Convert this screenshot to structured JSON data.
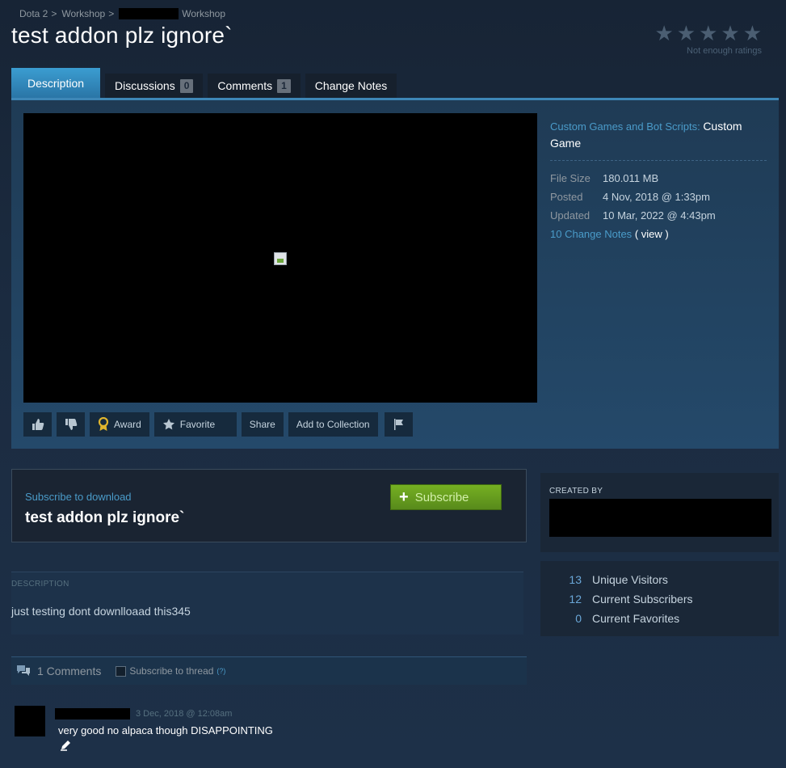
{
  "breadcrumb": {
    "items": [
      "Dota 2",
      "Workshop",
      "Workshop"
    ],
    "separator": ">"
  },
  "title": "test addon plz ignore`",
  "rating": {
    "stars": [
      "★",
      "★",
      "★",
      "★",
      "★"
    ],
    "text": "Not enough ratings"
  },
  "tabs": [
    {
      "label": "Description"
    },
    {
      "label": "Discussions",
      "badge": "0"
    },
    {
      "label": "Comments",
      "badge": "1"
    },
    {
      "label": "Change Notes"
    }
  ],
  "actions": {
    "award": "Award",
    "favorite": "Favorite",
    "share": "Share",
    "add_to_collection": "Add to Collection"
  },
  "meta": {
    "category_label": "Custom Games and Bot Scripts:",
    "category_value": "Custom Game",
    "file_size_label": "File Size",
    "file_size": "180.011 MB",
    "posted_label": "Posted",
    "posted": "4 Nov, 2018 @ 1:33pm",
    "updated_label": "Updated",
    "updated": "10 Mar, 2022 @ 4:43pm",
    "change_notes": "10 Change Notes",
    "view": "( view )"
  },
  "subscribe": {
    "label": "Subscribe to download",
    "title": "test addon plz ignore`",
    "button": "Subscribe",
    "plus": "+"
  },
  "description": {
    "label": "DESCRIPTION",
    "text": "just testing dont downlloaad this345"
  },
  "comments": {
    "count_label": "1 Comments",
    "subscribe_thread": "Subscribe to thread",
    "help": "(?)",
    "items": [
      {
        "date": "3 Dec, 2018 @ 12:08am",
        "text": "very good no alpaca though DISAPPOINTING"
      }
    ]
  },
  "sidebar": {
    "created_by": "CREATED BY",
    "stats": [
      {
        "value": "13",
        "label": "Unique Visitors"
      },
      {
        "value": "12",
        "label": "Current Subscribers"
      },
      {
        "value": "0",
        "label": "Current Favorites"
      }
    ]
  },
  "colors": {
    "accent": "#4a9bc9",
    "tab_active": "#3b9dd1",
    "subscribe_green": "#75b022",
    "background": "#1b2838"
  },
  "icons": {
    "thumbs_up": "thumbs-up-icon",
    "thumbs_down": "thumbs-down-icon",
    "award": "award-ribbon-icon",
    "favorite": "star-icon",
    "flag": "flag-icon",
    "comments": "speech-bubble-icon"
  }
}
